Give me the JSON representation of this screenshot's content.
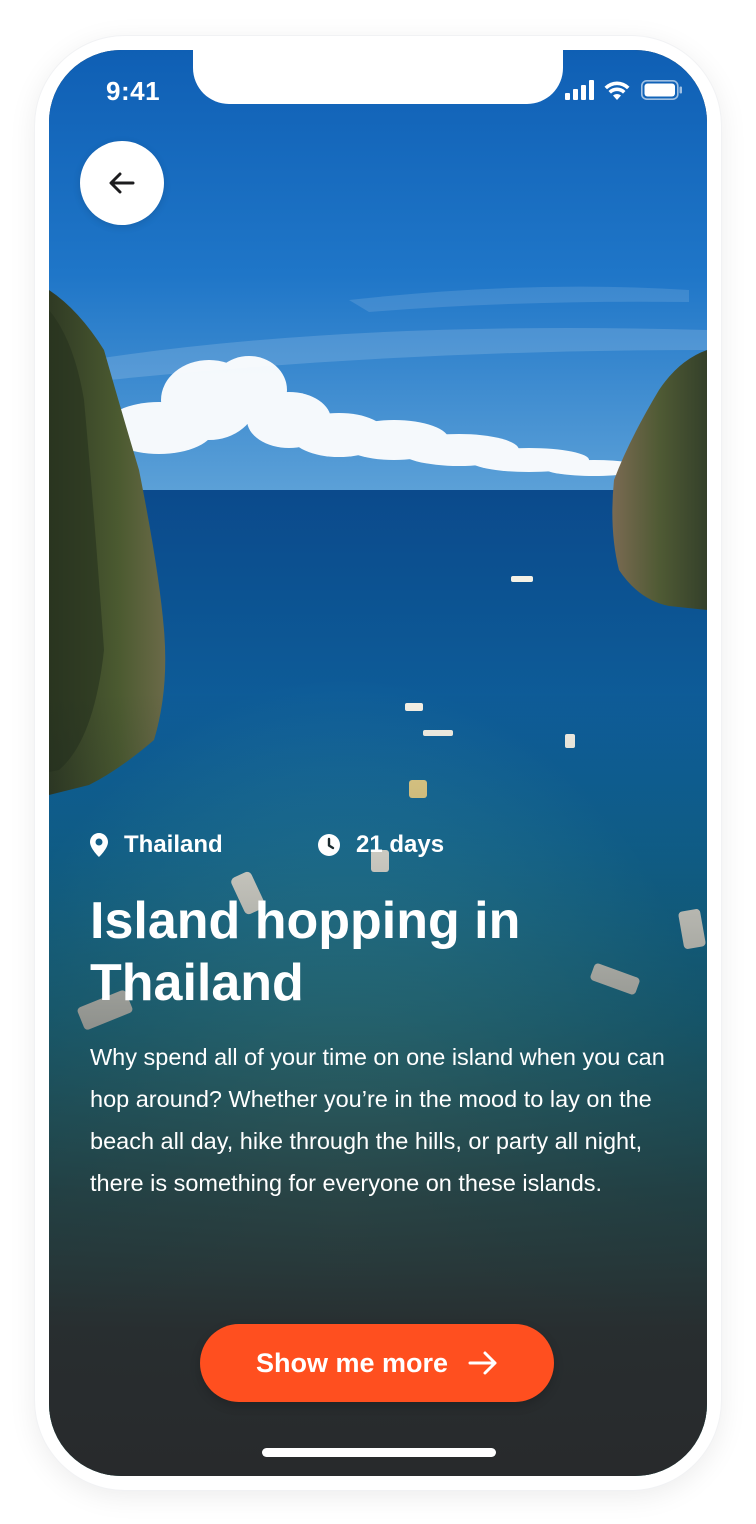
{
  "status_bar": {
    "time": "9:41",
    "icons": [
      "signal-icon",
      "wifi-icon",
      "battery-icon"
    ]
  },
  "nav": {
    "back_icon": "arrow-left-icon"
  },
  "trip": {
    "location": "Thailand",
    "location_icon": "map-pin-icon",
    "duration": "21 days",
    "duration_icon": "clock-icon",
    "title": "Island hopping in Thailand",
    "description": "Why spend all of your time on one island when you can hop around? Whether you’re in the mood to lay on the beach all day, hike through the hills, or party all night, there is something for everyone on these islands."
  },
  "cta": {
    "label": "Show me more",
    "icon": "arrow-right-icon"
  },
  "colors": {
    "accent": "#ff4f1f",
    "text_on_image": "#ffffff",
    "overlay_dark": "#282a2c"
  }
}
